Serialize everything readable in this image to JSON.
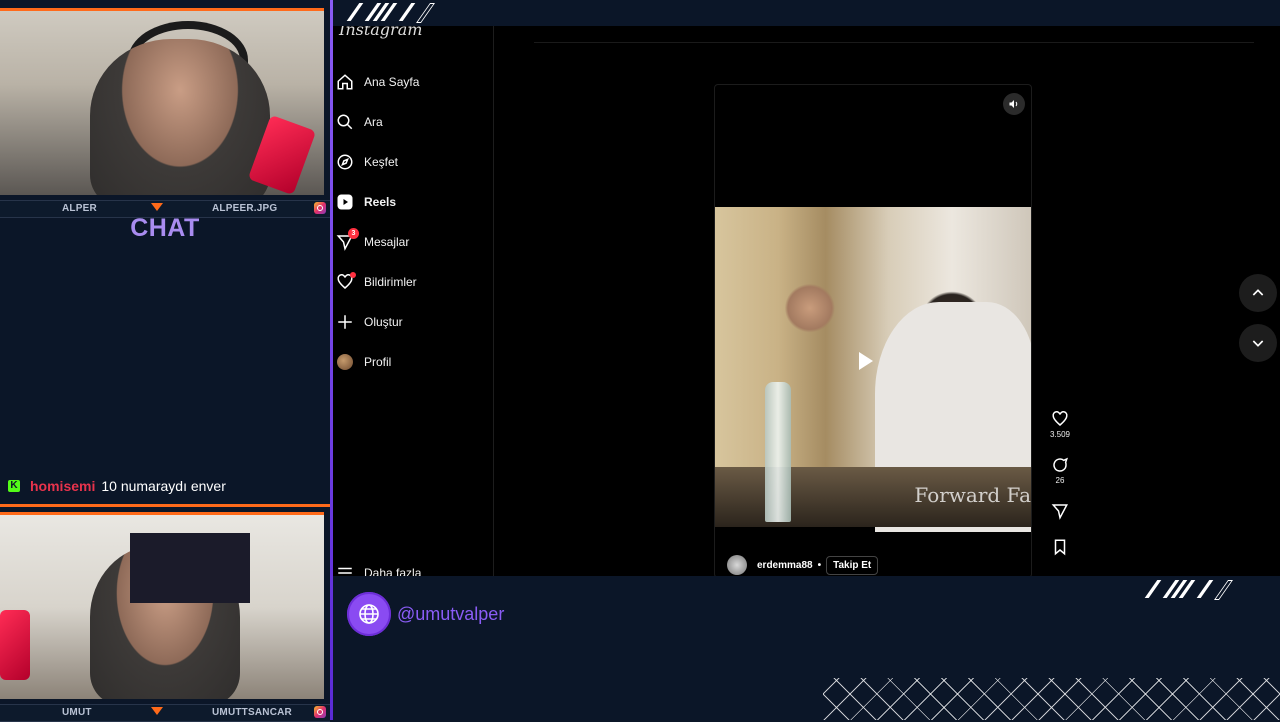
{
  "overlay": {
    "top_cam": {
      "name_left": "ALPER",
      "name_right": "ALPEER.JPG"
    },
    "chat_title": "CHAT",
    "chat_message": {
      "user": "homisemi",
      "text": "10 numaraydı enver",
      "platform_icon": "kick-icon"
    },
    "bottom_cam": {
      "name_left": "UMUT",
      "name_right": "UMUTTSANCAR"
    },
    "handle": "@umutvalper",
    "accent_color": "#8a5cf5",
    "highlight_color": "#ff6a1a"
  },
  "instagram": {
    "logo": "Instagram",
    "nav": [
      {
        "label": "Ana Sayfa",
        "icon": "home-icon"
      },
      {
        "label": "Ara",
        "icon": "search-icon"
      },
      {
        "label": "Keşfet",
        "icon": "compass-icon"
      },
      {
        "label": "Reels",
        "icon": "reels-icon",
        "active": true
      },
      {
        "label": "Mesajlar",
        "icon": "messenger-icon",
        "badge": "3"
      },
      {
        "label": "Bildirimler",
        "icon": "heart-icon",
        "dot": true
      },
      {
        "label": "Oluştur",
        "icon": "plus-icon"
      },
      {
        "label": "Profil",
        "icon": "avatar-icon"
      }
    ],
    "more_label": "Daha fazla",
    "reel": {
      "username": "erdemma88",
      "separator": "•",
      "follow_label": "Takip Et",
      "watermark": "Forward Fa",
      "likes": "3.509",
      "comments": "26"
    }
  }
}
